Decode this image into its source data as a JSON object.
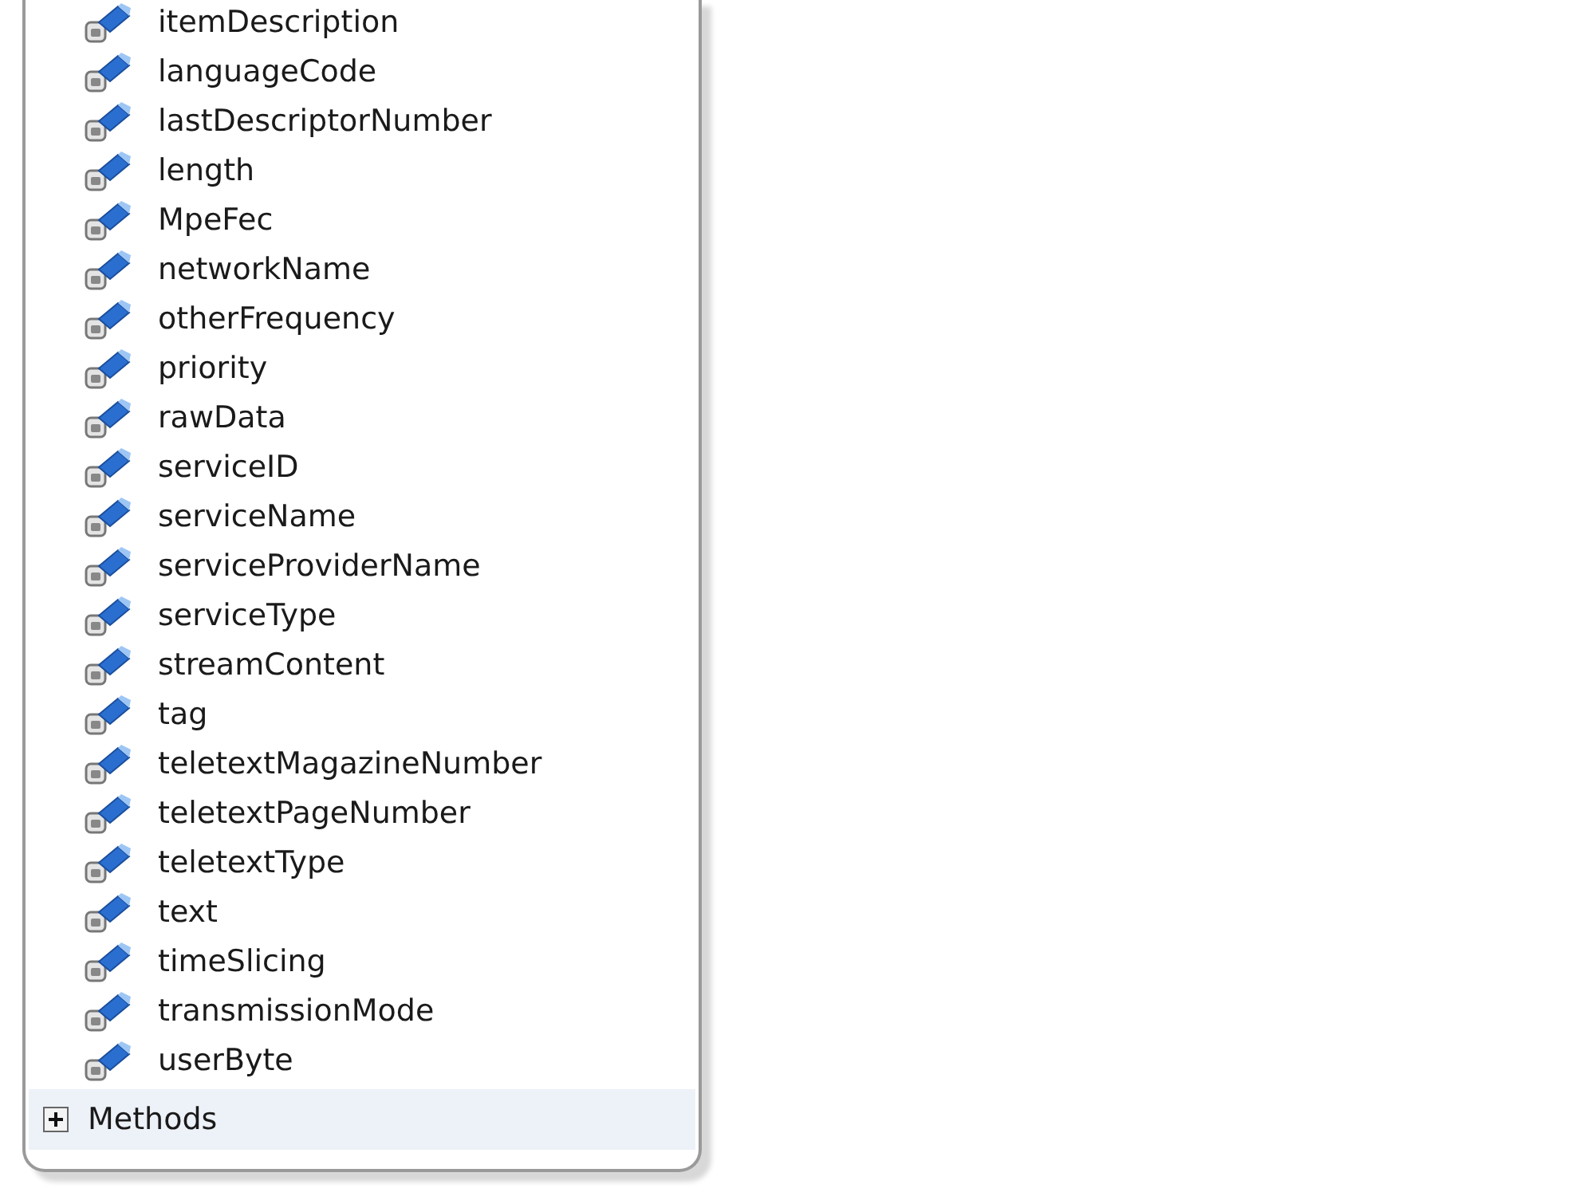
{
  "properties": [
    "itemDescription",
    "languageCode",
    "lastDescriptorNumber",
    "length",
    "MpeFec",
    "networkName",
    "otherFrequency",
    "priority",
    "rawData",
    "serviceID",
    "serviceName",
    "serviceProviderName",
    "serviceType",
    "streamContent",
    "tag",
    "teletextMagazineNumber",
    "teletextPageNumber",
    "teletextType",
    "text",
    "timeSlicing",
    "transmissionMode",
    "userByte"
  ],
  "section": {
    "label": "Methods",
    "expanded": false
  }
}
